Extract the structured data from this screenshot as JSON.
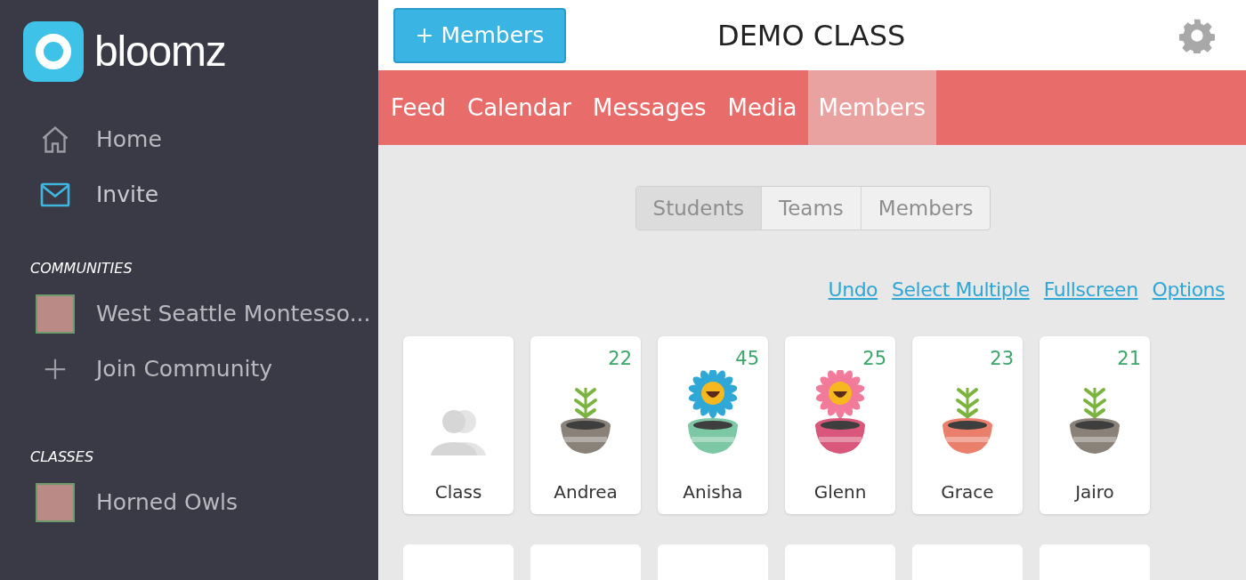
{
  "sidebar": {
    "logo_text": "bloomz",
    "nav": [
      {
        "label": "Home",
        "kind": "home",
        "selected": false
      },
      {
        "label": "Invite",
        "kind": "mail",
        "selected": true
      }
    ],
    "communities": {
      "heading": "COMMUNITIES",
      "items": [
        {
          "label": "West Seattle Montesso...",
          "kind": "thumb"
        },
        {
          "label": "Join Community",
          "kind": "plus"
        }
      ]
    },
    "classes": {
      "heading": "CLASSES",
      "items": [
        {
          "label": "Horned Owls",
          "kind": "thumb"
        }
      ]
    }
  },
  "header": {
    "add_button": "+ Members",
    "title": "DEMO CLASS"
  },
  "tabs": [
    {
      "label": "Feed",
      "selected": false
    },
    {
      "label": "Calendar",
      "selected": false
    },
    {
      "label": "Messages",
      "selected": false
    },
    {
      "label": "Media",
      "selected": false
    },
    {
      "label": "Members",
      "selected": true
    }
  ],
  "segments": [
    {
      "label": "Students",
      "selected": true
    },
    {
      "label": "Teams",
      "selected": false
    },
    {
      "label": "Members",
      "selected": false
    }
  ],
  "links": [
    "Undo",
    "Select Multiple",
    "Fullscreen",
    "Options"
  ],
  "cards": [
    {
      "name": "Class",
      "kind": "class"
    },
    {
      "name": "Andrea",
      "kind": "sprout",
      "points": "22",
      "pot": {
        "color": "#8a8279"
      }
    },
    {
      "name": "Anisha",
      "kind": "flower",
      "points": "45",
      "pot": {
        "color": "#7cc8a4"
      },
      "flower": {
        "color": "#2fa8d8"
      }
    },
    {
      "name": "Glenn",
      "kind": "flower",
      "points": "25",
      "pot": {
        "color": "#d9577a"
      },
      "flower": {
        "color": "#f27a9a"
      }
    },
    {
      "name": "Grace",
      "kind": "sprout",
      "points": "23",
      "pot": {
        "color": "#ea7f6c"
      }
    },
    {
      "name": "Jairo",
      "kind": "sprout",
      "points": "21",
      "pot": {
        "color": "#8a8279"
      }
    }
  ]
}
